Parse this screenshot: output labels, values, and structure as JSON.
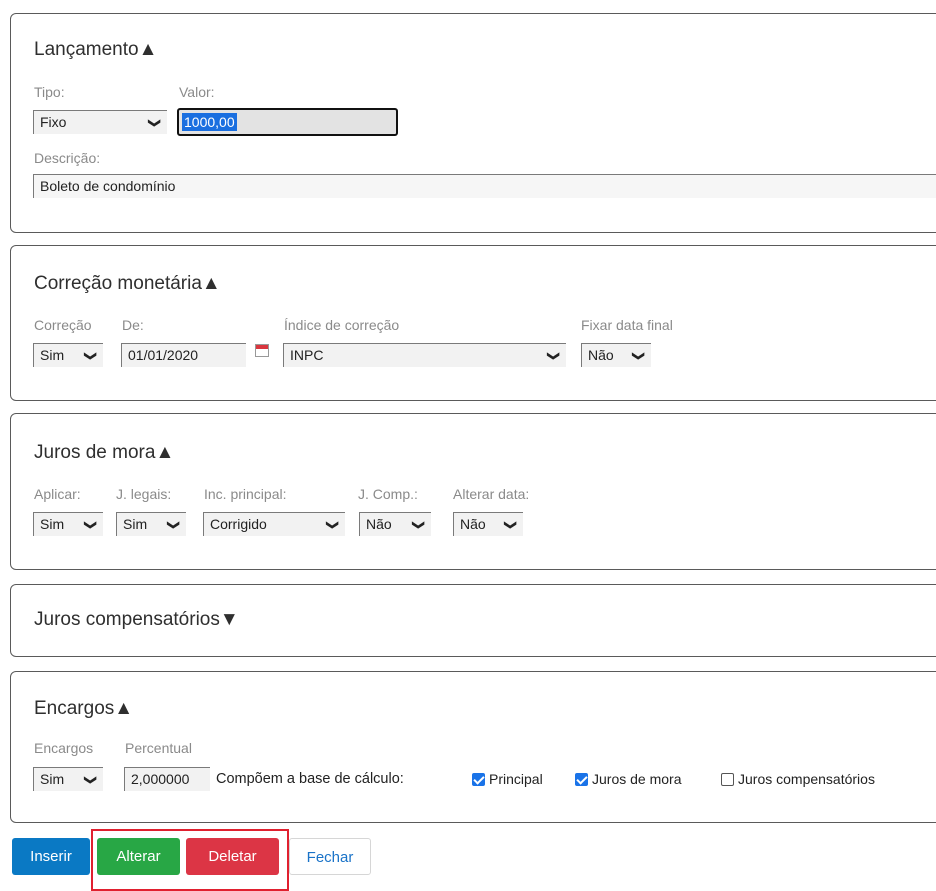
{
  "lancamento": {
    "title": "Lançamento▲",
    "tipo_label": "Tipo:",
    "tipo_value": "Fixo",
    "valor_label": "Valor:",
    "valor_value": "1000,00",
    "descricao_label": "Descrição:",
    "descricao_value": "Boleto de condomínio"
  },
  "correcao": {
    "title": "Correção monetária▲",
    "correcao_label": "Correção",
    "correcao_value": "Sim",
    "de_label": "De:",
    "de_value": "01/01/2020",
    "indice_label": "Índice de correção",
    "indice_value": "INPC",
    "fixar_label": "Fixar data final",
    "fixar_value": "Não"
  },
  "juros_mora": {
    "title": "Juros de mora▲",
    "aplicar_label": "Aplicar:",
    "aplicar_value": "Sim",
    "legais_label": "J. legais:",
    "legais_value": "Sim",
    "inc_label": "Inc. principal:",
    "inc_value": "Corrigido",
    "comp_label": "J. Comp.:",
    "comp_value": "Não",
    "alterar_label": "Alterar data:",
    "alterar_value": "Não"
  },
  "juros_comp": {
    "title": "Juros compensatórios▼"
  },
  "encargos": {
    "title": "Encargos▲",
    "encargos_label": "Encargos",
    "encargos_value": "Sim",
    "percentual_label": "Percentual",
    "percentual_value": "2,000000",
    "base_label": "Compõem a base de cálculo:",
    "cb_principal": "Principal",
    "cb_mora": "Juros de mora",
    "cb_comp": "Juros compensatórios"
  },
  "buttons": {
    "inserir": "Inserir",
    "alterar": "Alterar",
    "deletar": "Deletar",
    "fechar": "Fechar"
  },
  "colors": {
    "inserir": "#0a79c4",
    "alterar": "#28a745",
    "deletar": "#dc3545",
    "highlight": "#e0202f",
    "checkbox": "#1a73e8"
  }
}
